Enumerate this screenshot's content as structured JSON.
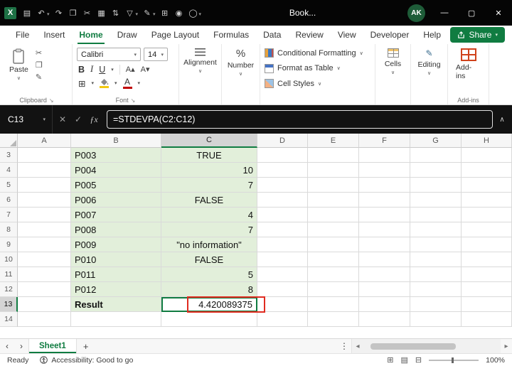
{
  "icons": {
    "app_logo": "X",
    "save": "▤",
    "undo": "↶",
    "redo": "↷",
    "paste_small": "❐",
    "cut": "✂",
    "picture": "▦",
    "sort": "⇅",
    "filter": "▽",
    "pen": "✎",
    "grid": "⊞",
    "record": "◉",
    "circle": "◯",
    "caret": "∨",
    "caret_small": "▾",
    "minimize": "—",
    "maximize": "▢",
    "close": "✕",
    "cancel": "✕",
    "check": "✓",
    "fx": "ƒx",
    "collapse": "∧",
    "ellipsis": "⋮",
    "prev": "‹",
    "next": "›",
    "scroll_left": "◂",
    "scroll_right": "▸",
    "plus": "+",
    "launcher": "↘",
    "borders": "⊞",
    "grow_font": "A▴",
    "shrink_font": "A▾",
    "bold": "B",
    "italic": "I",
    "underline": "U",
    "percent": "%",
    "view_normal": "⊞",
    "view_layout": "▤",
    "view_break": "⊟"
  },
  "title_bar": {
    "title": "Book...",
    "avatar": "AK"
  },
  "menu": {
    "tabs": [
      {
        "label": "File"
      },
      {
        "label": "Insert"
      },
      {
        "label": "Home"
      },
      {
        "label": "Draw"
      },
      {
        "label": "Page Layout"
      },
      {
        "label": "Formulas"
      },
      {
        "label": "Data"
      },
      {
        "label": "Review"
      },
      {
        "label": "View"
      },
      {
        "label": "Developer"
      },
      {
        "label": "Help"
      }
    ],
    "share_label": "Share"
  },
  "ribbon": {
    "paste_label": "Paste",
    "clipboard_group": "Clipboard",
    "font_family": "Calibri",
    "font_size": "14",
    "font_group": "Font",
    "alignment_label": "Alignment",
    "number_label": "Number",
    "styles": {
      "conditional_formatting": "Conditional Formatting",
      "format_as_table": "Format as Table",
      "cell_styles": "Cell Styles"
    },
    "cells_label": "Cells",
    "editing_label": "Editing",
    "addins_label": "Add-ins",
    "addins_group": "Add-ins"
  },
  "formula_bar": {
    "name_box": "C13",
    "formula": "=STDEVPA(C2:C12)"
  },
  "grid": {
    "columns": [
      "A",
      "B",
      "C",
      "D",
      "E",
      "F",
      "G",
      "H"
    ],
    "rows": [
      {
        "n": "3",
        "b": "P003",
        "c": "TRUE"
      },
      {
        "n": "4",
        "b": "P004",
        "c": "10"
      },
      {
        "n": "5",
        "b": "P005",
        "c": "7"
      },
      {
        "n": "6",
        "b": "P006",
        "c": "FALSE"
      },
      {
        "n": "7",
        "b": "P007",
        "c": "4"
      },
      {
        "n": "8",
        "b": "P008",
        "c": "7"
      },
      {
        "n": "9",
        "b": "P009",
        "c": "\"no information\""
      },
      {
        "n": "10",
        "b": "P010",
        "c": "FALSE"
      },
      {
        "n": "11",
        "b": "P011",
        "c": "5"
      },
      {
        "n": "12",
        "b": "P012",
        "c": "8"
      },
      {
        "n": "13",
        "b": "Result",
        "c": "4.420089375"
      },
      {
        "n": "14",
        "b": "",
        "c": ""
      }
    ],
    "selected_cell": "C13"
  },
  "sheet_bar": {
    "tab": "Sheet1"
  },
  "status_bar": {
    "ready": "Ready",
    "accessibility": "Accessibility: Good to go",
    "zoom": "100%"
  }
}
